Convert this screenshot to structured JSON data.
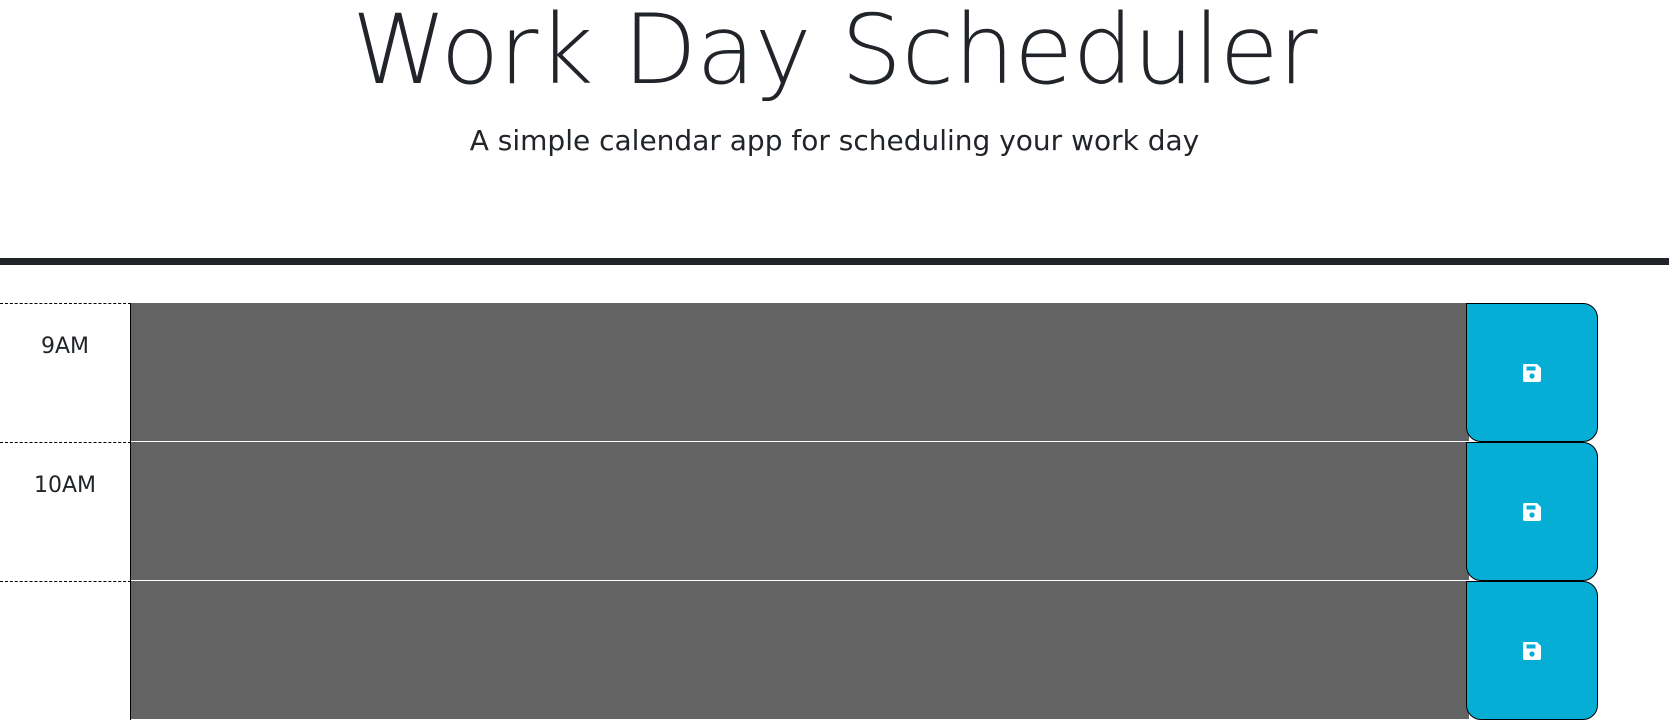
{
  "header": {
    "title": "Work Day Scheduler",
    "subtitle": "A simple calendar app for scheduling your work day"
  },
  "time_blocks": [
    {
      "hour": "9AM",
      "text": "",
      "status": "past"
    },
    {
      "hour": "10AM",
      "text": "",
      "status": "past"
    },
    {
      "hour": "",
      "text": "",
      "status": "past"
    }
  ],
  "icons": {
    "save": "floppy-disk-save-icon"
  },
  "colors": {
    "past": "#636363",
    "save_button": "#06aed5",
    "header_rule": "#212529",
    "text": "#212529"
  }
}
